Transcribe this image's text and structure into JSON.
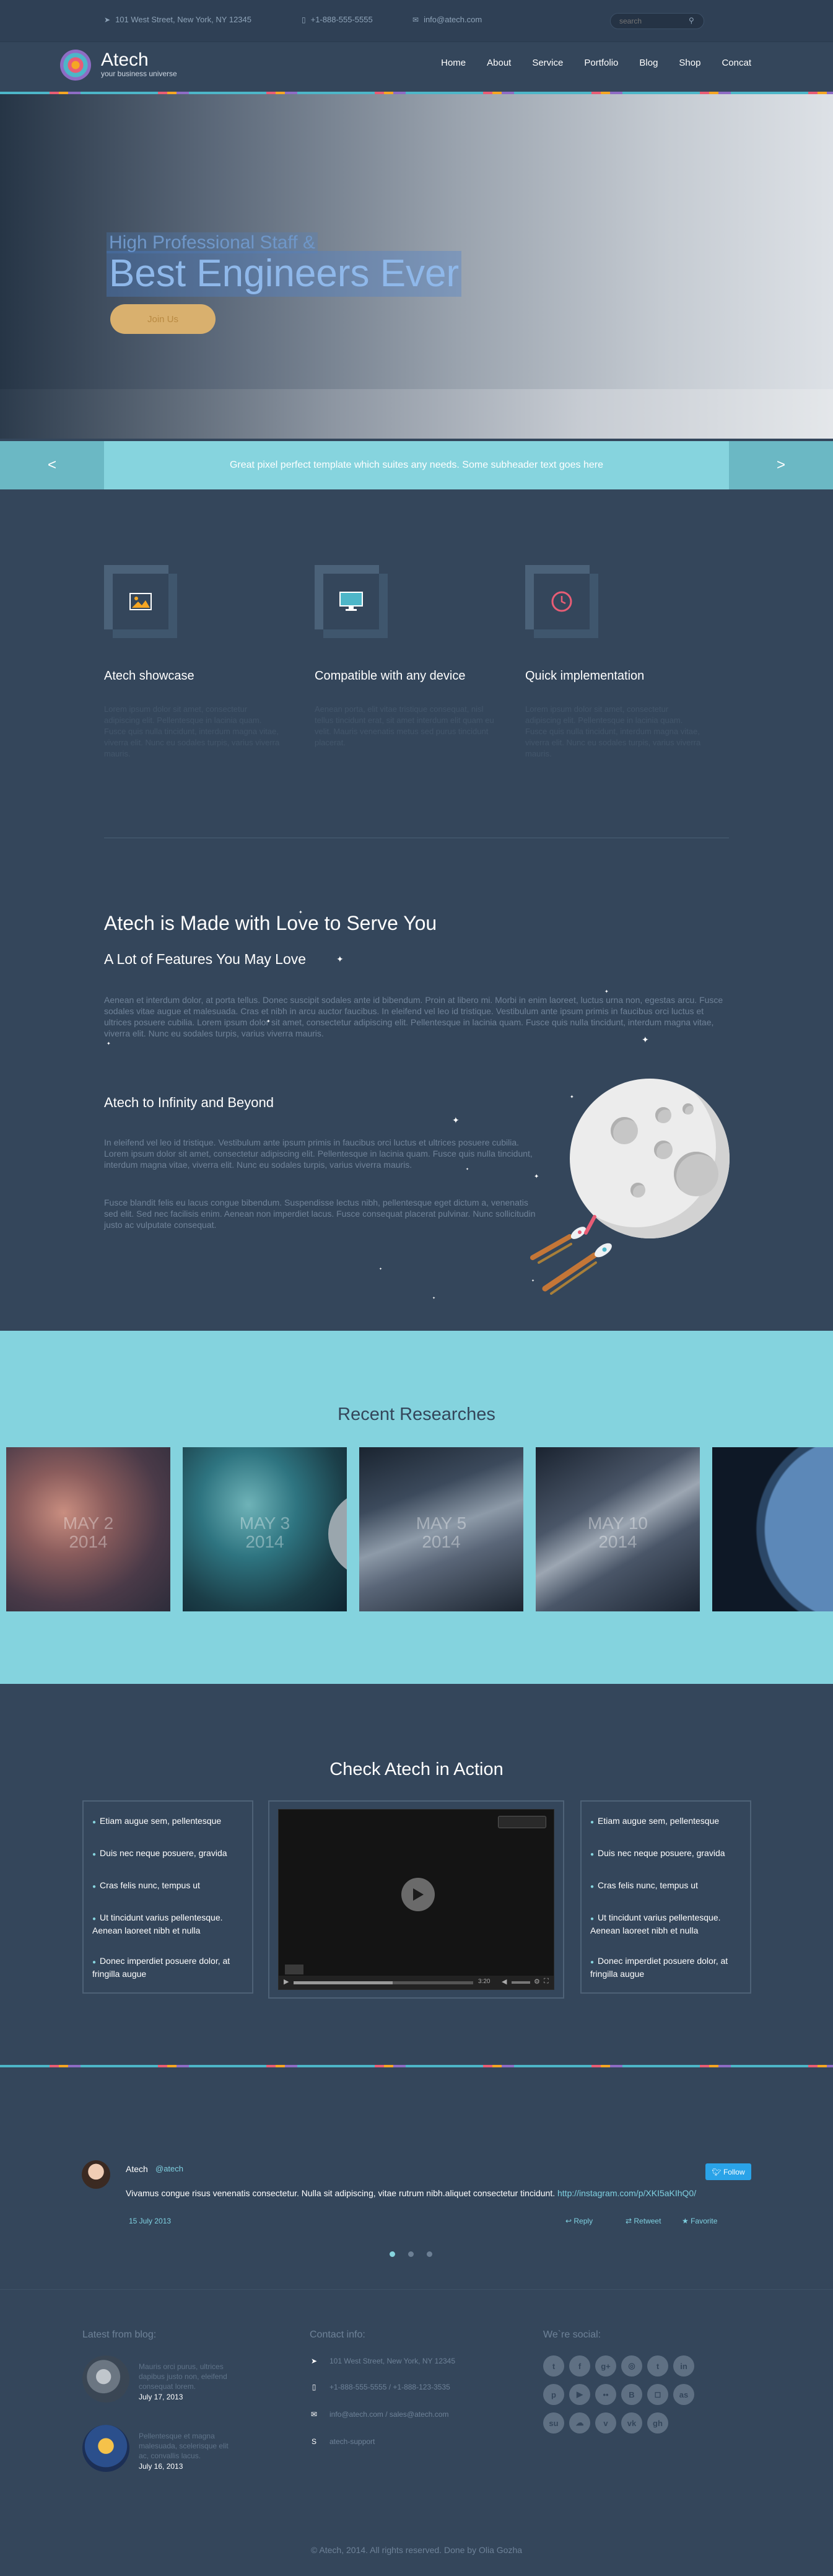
{
  "topbar": {
    "address": "101 West Street, New York, NY 12345",
    "phone": "+1-888-555-5555",
    "email": "info@atech.com",
    "search_placeholder": "search"
  },
  "brand": {
    "name": "Atech",
    "tagline": "your business universe"
  },
  "nav": [
    "Home",
    "About",
    "Service",
    "Portfolio",
    "Blog",
    "Shop",
    "Concat"
  ],
  "hero": {
    "line1": "High Professional Staff &",
    "line2": "Best Engineers Ever",
    "button": "Join Us"
  },
  "band": {
    "text": "Great pixel perfect template which suites any needs. Some subheader text goes here",
    "prev": "<",
    "next": ">"
  },
  "features": [
    {
      "title": "Atech showcase",
      "icon": "image-icon",
      "text": "Lorem ipsum dolor sit amet, consectetur adipiscing elit. Pellentesque in lacinia quam. Fusce quis nulla tincidunt, interdum magna vitae, viverra elit. Nunc eu sodales turpis, varius viverra mauris."
    },
    {
      "title": "Compatible with any device",
      "icon": "monitor-icon",
      "text": "Aenean porta, elit vitae tristique consequat, nisl tellus tincidunt erat, sit amet interdum elit quam eu velit. Mauris venenatis metus sed purus tincidunt placerat."
    },
    {
      "title": "Quick implementation",
      "icon": "clock-icon",
      "text": "Lorem ipsum dolor sit amet, consectetur adipiscing elit. Pellentesque in lacinia quam. Fusce quis nulla tincidunt, interdum magna vitae, viverra elit. Nunc eu sodales turpis, varius viverra mauris."
    }
  ],
  "about": {
    "title": "Atech is Made with Love to Serve You",
    "subtitle": "A Lot of Features You May Love",
    "para1": "Aenean et interdum dolor, at porta tellus. Donec suscipit sodales ante id bibendum. Proin at libero mi. Morbi in enim laoreet, luctus urna non, egestas arcu. Fusce sodales vitae augue et malesuada. Cras et nibh in arcu auctor faucibus. In eleifend vel leo id tristique. Vestibulum ante ipsum primis in faucibus orci luctus et ultrices posuere cubilia. Lorem ipsum dolor sit amet, consectetur adipiscing elit. Pellentesque in lacinia quam. Fusce quis nulla tincidunt, interdum magna vitae, viverra elit. Nunc eu sodales turpis, varius viverra mauris.",
    "infinity_title": "Atech to Infinity and Beyond",
    "para2": "In eleifend vel leo id tristique. Vestibulum ante ipsum primis in faucibus orci luctus et ultrices posuere cubilia. Lorem ipsum dolor sit amet, consectetur adipiscing elit. Pellentesque in lacinia quam. Fusce quis nulla tincidunt, interdum magna vitae, viverra elit. Nunc eu sodales turpis, varius viverra mauris.",
    "para3": "Fusce blandit felis eu lacus congue bibendum. Suspendisse lectus nibh, pellentesque eget dictum a, venenatis sed elit. Sed nec facilisis enim. Aenean non imperdiet lacus. Fusce consequat placerat pulvinar. Nunc sollicitudin justo ac vulputate consequat."
  },
  "research": {
    "title": "Recent Researches",
    "cards": [
      {
        "month": "MAY 2",
        "year": "2014"
      },
      {
        "month": "MAY 3",
        "year": "2014"
      },
      {
        "month": "MAY 5",
        "year": "2014"
      },
      {
        "month": "MAY 10",
        "year": "2014"
      }
    ]
  },
  "action": {
    "title": "Check Atech in Action",
    "list_left": [
      "Etiam augue sem, pellentesque",
      "Duis nec neque posuere, gravida",
      "Cras felis nunc, tempus ut",
      "Ut tincidunt varius pellentesque. Aenean laoreet nibh et nulla",
      "Donec imperdiet posuere dolor, at fringilla augue"
    ],
    "list_right": [
      "Etiam augue sem, pellentesque",
      "Duis nec neque posuere, gravida",
      "Cras felis nunc, tempus ut",
      "Ut tincidunt varius pellentesque. Aenean laoreet nibh et nulla",
      "Donec imperdiet posuere dolor, at fringilla augue"
    ],
    "video_time": "3:20",
    "video_progress": 0.55
  },
  "tweet": {
    "name": "Atech",
    "handle": "@atech",
    "text": "Vivamus congue risus venenatis consectetur. Nulla sit adipiscing, vitae rutrum nibh.aliquet consectetur tincidunt.",
    "link": "http://instagram.com/p/XKI5aKIhQ0/",
    "follow": "Follow",
    "date": "15 July 2013",
    "reply": "Reply",
    "retweet": "Retweet",
    "favorite": "Favorite"
  },
  "footer": {
    "blog_heading": "Latest from blog:",
    "blog_posts": [
      {
        "text": "Mauris orci purus, ultrices dapibus justo non, eleifend consequat lorem.",
        "date": "July 17, 2013"
      },
      {
        "text": "Pellentesque et magna malesuada, scelerisque elit ac, convallis lacus.",
        "date": "July 16, 2013"
      }
    ],
    "contact_heading": "Contact info:",
    "contact": {
      "address": "101 West Street, New York, NY 12345",
      "phones": "+1-888-555-5555 / +1-888-123-3535",
      "emails": "info@atech.com / sales@atech.com",
      "skype": "atech-support"
    },
    "social_heading": "We`re social:",
    "social_icons": [
      "twitter-icon",
      "facebook-icon",
      "google-plus-icon",
      "dribbble-icon",
      "tumblr-icon",
      "linkedin-icon",
      "pinterest-icon",
      "youtube-icon",
      "flickr-icon",
      "blogger-icon",
      "instagram-icon",
      "lastfm-icon",
      "stumbleupon-icon",
      "soundcloud-icon",
      "vimeo-icon",
      "vk-icon",
      "github-icon"
    ],
    "copyright": "© Atech, 2014. All rights reserved. Done by Olia Gozha"
  },
  "colors": {
    "background": "#34465b",
    "accent": "#86d4de",
    "button": "#d9b06e",
    "twitter": "#2aa3e8"
  }
}
